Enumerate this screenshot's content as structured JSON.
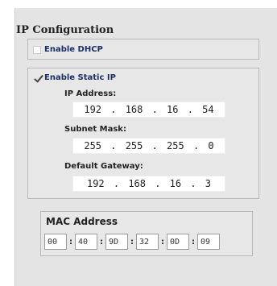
{
  "ip_config": {
    "title": "IP Configuration",
    "dhcp": {
      "label": "Enable DHCP",
      "checked": false
    },
    "static": {
      "label": "Enable Static IP",
      "checked": true,
      "ip_address": {
        "label": "IP Address:",
        "value": "192 . 168 . 16 . 54"
      },
      "subnet_mask": {
        "label": "Subnet Mask:",
        "value": "255 . 255 . 255 . 0"
      },
      "default_gateway": {
        "label": "Default Gateway:",
        "value": "192 . 168 . 16 . 3"
      }
    }
  },
  "mac": {
    "title": "MAC Address",
    "separator": ":",
    "octets": [
      "00",
      "40",
      "9D",
      "32",
      "0D",
      "09"
    ]
  }
}
